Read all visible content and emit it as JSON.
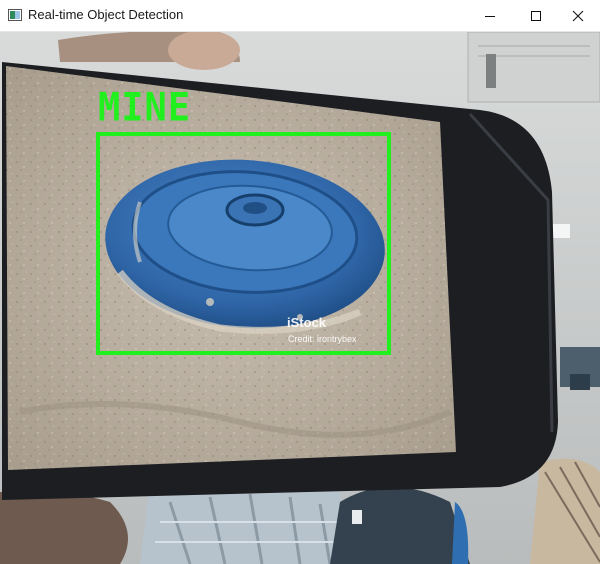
{
  "window": {
    "title": "Real-time Object Detection",
    "controls": {
      "minimize": "minimize-icon",
      "maximize": "maximize-icon",
      "close": "close-icon"
    }
  },
  "detection": {
    "label": "MINE",
    "box_color": "#22f01e"
  },
  "phone_image": {
    "watermark": "iStock",
    "credit": "Credit: irontrybex"
  }
}
